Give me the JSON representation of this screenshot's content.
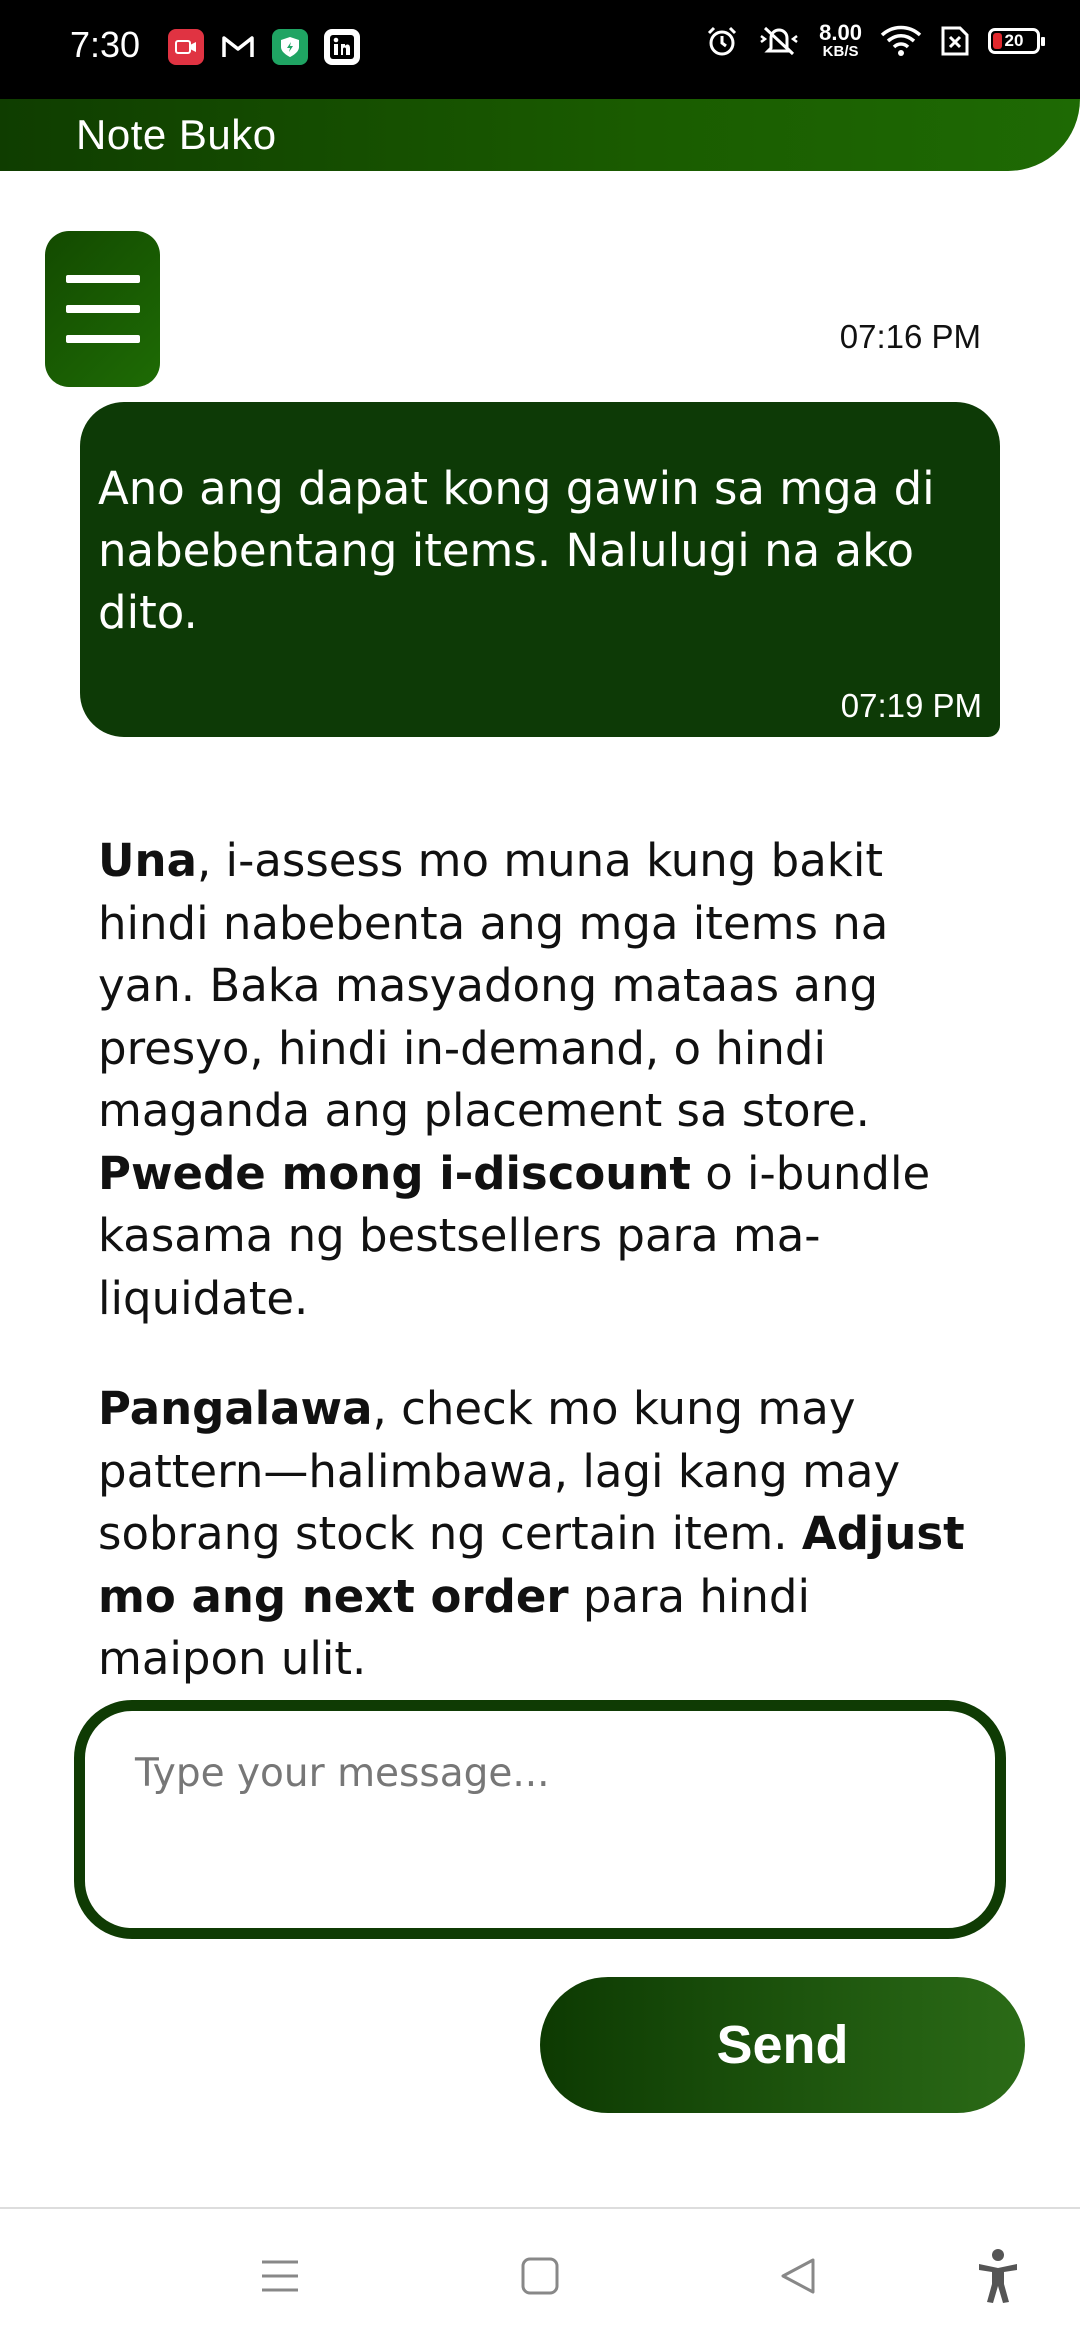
{
  "status_bar": {
    "time": "7:30",
    "net_speed_value": "8.00",
    "net_speed_unit": "KB/S",
    "battery_level": "20",
    "icons": [
      "screen-record-icon",
      "gmail-icon",
      "vpn-shield-icon",
      "linkedin-icon",
      "alarm-icon",
      "vibrate-off-icon",
      "wifi-icon",
      "sim-off-icon",
      "battery-icon"
    ]
  },
  "header": {
    "title": "Note Buko"
  },
  "chat": {
    "standalone_timestamp": "07:16 PM",
    "user_message": {
      "text": "Ano ang dapat kong gawin sa mga di nabebentang items. Nalulugi na ako dito.",
      "timestamp": "07:19 PM"
    },
    "reply_paragraphs": [
      {
        "lead_bold": "Una",
        "text_1": ", i-assess mo muna kung bakit hindi nabebenta ang mga items na yan. Baka masyadong mataas ang presyo, hindi in-demand, o hindi maganda ang placement sa store. ",
        "mid_bold": "Pwede mong i-discount",
        "text_2": " o i-bundle kasama ng bestsellers para ma-liquidate."
      },
      {
        "lead_bold": "Pangalawa",
        "text_1": ", check mo kung may pattern—halimbawa, lagi kang may sobrang stock ng certain item. ",
        "mid_bold": "Adjust mo ang next order",
        "text_2": " para hindi maipon ulit."
      }
    ]
  },
  "composer": {
    "placeholder": "Type your message...",
    "send_label": "Send"
  },
  "colors": {
    "brand_dark": "#0d3a06",
    "brand": "#1a5c00"
  }
}
